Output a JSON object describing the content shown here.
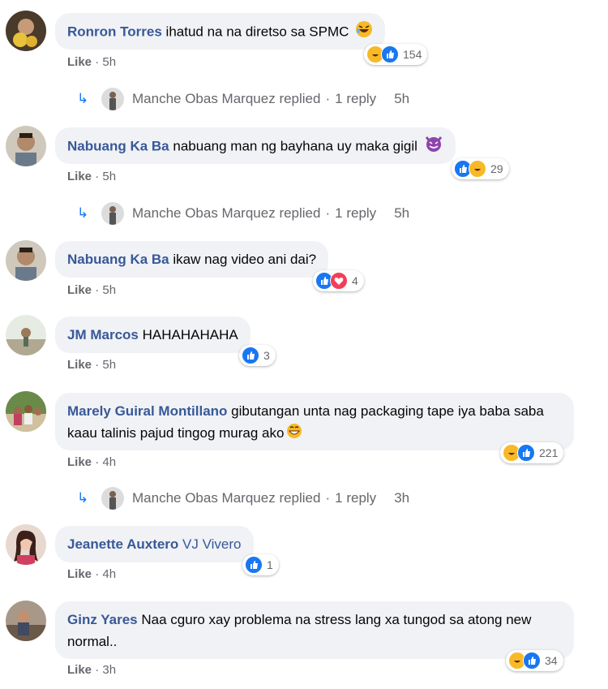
{
  "comments": [
    {
      "author": "Ronron Torres",
      "text": "ihatud na na diretso sa SPMC",
      "like": "Like",
      "time": "5h",
      "reactions": "154",
      "emoji": "haha"
    },
    {
      "author": "Nabuang Ka Ba",
      "text": "nabuang man ng bayhana uy maka gigil",
      "like": "Like",
      "time": "5h",
      "reactions": "29",
      "emoji": "devil"
    },
    {
      "author": "Nabuang Ka Ba",
      "text": "ikaw nag video ani dai?",
      "like": "Like",
      "time": "5h",
      "reactions": "4"
    },
    {
      "author": "JM Marcos",
      "text": "HAHAHAHAHA",
      "like": "Like",
      "time": "5h",
      "reactions": "3"
    },
    {
      "author": "Marely Guiral Montillano",
      "text": "gibutangan unta nag packaging tape iya baba saba kaau talinis pajud tingog murag ako",
      "like": "Like",
      "time": "4h",
      "reactions": "221",
      "emoji": "grin"
    },
    {
      "author": "Jeanette Auxtero",
      "tag": "VJ Vivero",
      "like": "Like",
      "time": "4h",
      "reactions": "1"
    },
    {
      "author": "Ginz Yares",
      "text": "Naa cguro xay problema na stress lang xa tungod sa atong new normal..",
      "like": "Like",
      "time": "3h",
      "reactions": "34"
    }
  ],
  "replies": [
    {
      "name": "Manche Obas Marquez",
      "verb": "replied",
      "count": "1 reply",
      "time": "5h"
    },
    {
      "name": "Manche Obas Marquez",
      "verb": "replied",
      "count": "1 reply",
      "time": "5h"
    },
    {
      "name": "Manche Obas Marquez",
      "verb": "replied",
      "count": "1 reply",
      "time": "3h"
    }
  ],
  "separator": "·",
  "colors": {
    "link": "#385898",
    "like": "#1877f2",
    "haha": "#f7b928",
    "love": "#f33e58",
    "bubble": "#f0f2f5",
    "meta": "#65676b"
  }
}
